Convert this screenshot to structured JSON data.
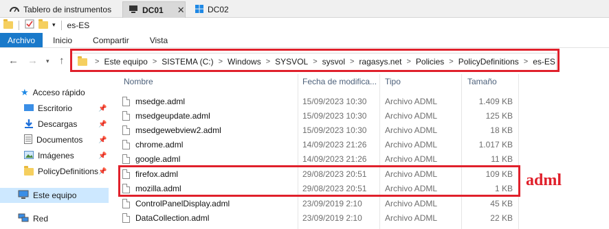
{
  "tabs": [
    {
      "label": "Tablero de instrumentos",
      "icon": "dashboard-icon"
    },
    {
      "label": "DC01",
      "icon": "server-icon",
      "active": true
    },
    {
      "label": "DC02",
      "icon": "windows-icon"
    }
  ],
  "tab_close": "✕",
  "quick_access": {
    "title": "es-ES"
  },
  "ribbon": {
    "file": "Archivo",
    "home": "Inicio",
    "share": "Compartir",
    "view": "Vista"
  },
  "breadcrumb": [
    "Este equipo",
    "SISTEMA (C:)",
    "Windows",
    "SYSVOL",
    "sysvol",
    "ragasys.net",
    "Policies",
    "PolicyDefinitions",
    "es-ES"
  ],
  "nav": {
    "quick_access": "Acceso rápido",
    "items": [
      {
        "label": "Escritorio",
        "icon": "desktop-icon",
        "pinned": true
      },
      {
        "label": "Descargas",
        "icon": "downloads-icon",
        "pinned": true
      },
      {
        "label": "Documentos",
        "icon": "documents-icon",
        "pinned": true
      },
      {
        "label": "Imágenes",
        "icon": "pictures-icon",
        "pinned": true
      },
      {
        "label": "PolicyDefinitions",
        "icon": "folder-icon",
        "pinned": true
      }
    ],
    "this_pc": "Este equipo",
    "network": "Red"
  },
  "columns": {
    "name": "Nombre",
    "date": "Fecha de modifica...",
    "type": "Tipo",
    "size": "Tamaño"
  },
  "files": [
    {
      "name": "msedge.adml",
      "date": "15/09/2023 10:30",
      "type": "Archivo ADML",
      "size": "1.409 KB"
    },
    {
      "name": "msedgeupdate.adml",
      "date": "15/09/2023 10:30",
      "type": "Archivo ADML",
      "size": "125 KB"
    },
    {
      "name": "msedgewebview2.adml",
      "date": "15/09/2023 10:30",
      "type": "Archivo ADML",
      "size": "18 KB"
    },
    {
      "name": "chrome.adml",
      "date": "14/09/2023 21:26",
      "type": "Archivo ADML",
      "size": "1.017 KB"
    },
    {
      "name": "google.adml",
      "date": "14/09/2023 21:26",
      "type": "Archivo ADML",
      "size": "11 KB"
    },
    {
      "name": "firefox.adml",
      "date": "29/08/2023 20:51",
      "type": "Archivo ADML",
      "size": "109 KB"
    },
    {
      "name": "mozilla.adml",
      "date": "29/08/2023 20:51",
      "type": "Archivo ADML",
      "size": "1 KB"
    },
    {
      "name": "ControlPanelDisplay.adml",
      "date": "23/09/2019 2:10",
      "type": "Archivo ADML",
      "size": "45 KB"
    },
    {
      "name": "DataCollection.adml",
      "date": "23/09/2019 2:10",
      "type": "Archivo ADML",
      "size": "22 KB"
    }
  ],
  "annotation": "adml",
  "colors": {
    "highlight": "#e0202b",
    "file_tab": "#1979ca",
    "selected": "#cde8ff"
  }
}
